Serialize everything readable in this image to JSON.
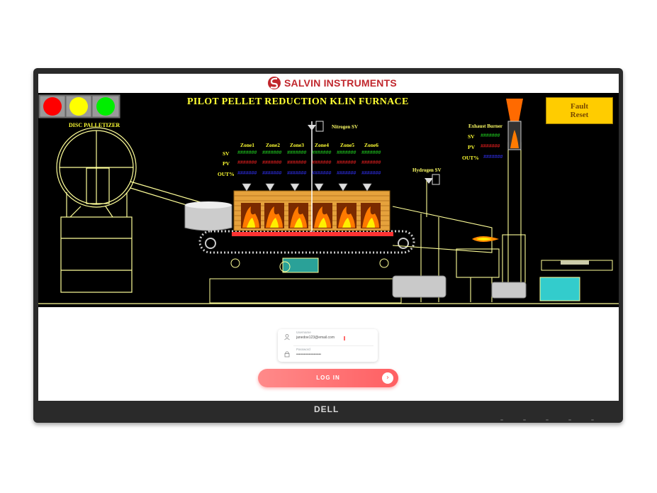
{
  "logo": {
    "text": "SALVIN INSTRUMENTS"
  },
  "hmi": {
    "title": "PILOT PELLET REDUCTION KLIN  FURNACE",
    "fault_reset": "Fault\nReset",
    "disc_palletizer": "DISC PALLETIZER",
    "nitrogen_sv": "Nitrogen SV",
    "hydrogen_sv": "Hydrogen SV",
    "exhaust_burner": "Exhaust Burner",
    "zones": [
      "Zone1",
      "Zone2",
      "Zone3",
      "Zone4",
      "Zone5",
      "Zone6"
    ],
    "row_labels": {
      "sv": "SV",
      "pv": "PV",
      "out": "OUT%"
    },
    "zone_values": {
      "sv": [
        "#######",
        "#######",
        "#######",
        "#######",
        "#######",
        "#######"
      ],
      "pv": [
        "#######",
        "#######",
        "#######",
        "#######",
        "#######",
        "#######"
      ],
      "out": [
        "#######",
        "#######",
        "#######",
        "#######",
        "#######",
        "#######"
      ]
    },
    "burner_values": {
      "sv": "#######",
      "pv": "#######",
      "out": "#######"
    },
    "colors": {
      "sv": "#22dd22",
      "pv": "#ff2222",
      "out": "#3333ff",
      "label": "#ffff33"
    },
    "indicator_lights": [
      "#ff0000",
      "#ffff00",
      "#00ee00"
    ]
  },
  "login": {
    "username_caption": "Username",
    "username_value": "janedoe123@email.com",
    "password_caption": "Password",
    "password_value": "••••••••••••••••••••",
    "button_label": "LOG IN",
    "button_arrow": "›"
  },
  "monitor": {
    "brand": "DELL"
  }
}
